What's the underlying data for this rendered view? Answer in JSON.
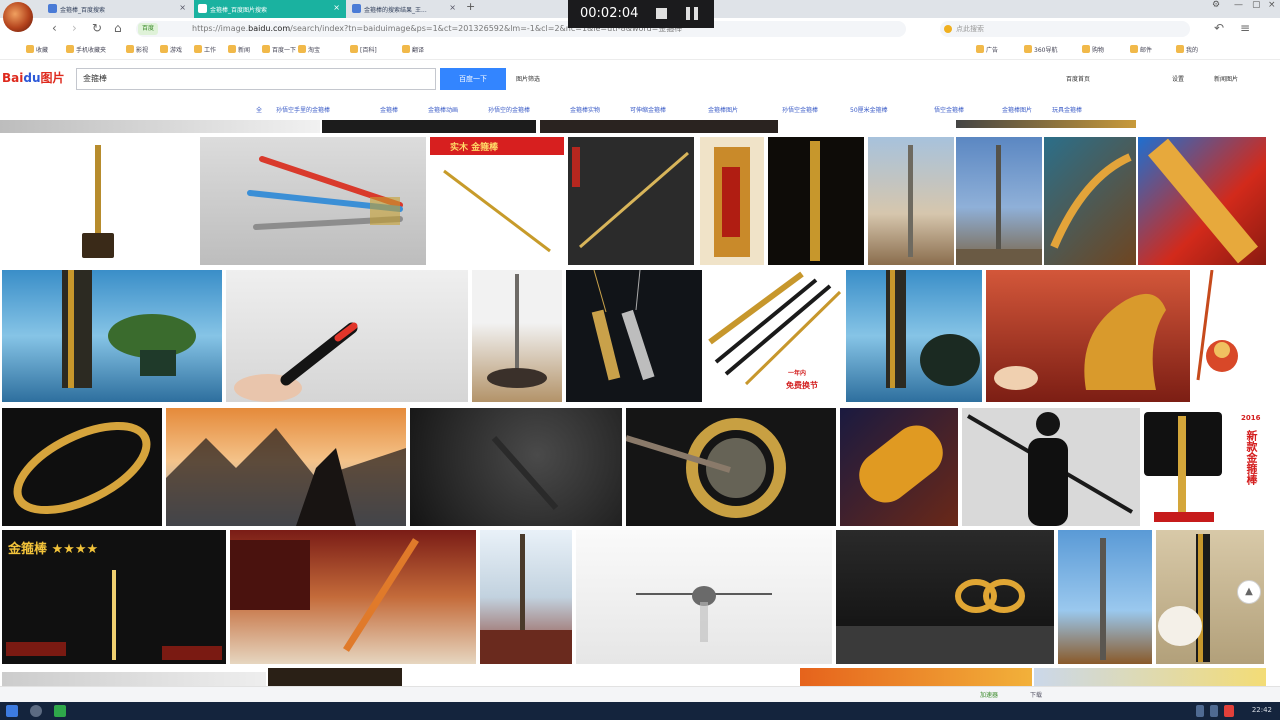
{
  "recorder": {
    "time": "00:02:04"
  },
  "tabs": [
    {
      "label": "金箍棒_百度搜索"
    },
    {
      "label": "金箍棒_百度图片搜索"
    },
    {
      "label": "金箍棒的搜索结果_王..."
    }
  ],
  "address": {
    "secure_tag": "百度",
    "url_prefix": "https://image.",
    "url_domain": "baidu.com",
    "url_rest": "/search/index?tn=baiduimage&ps=1&ct=201326592&lm=-1&cl=2&nc=1&ie=utf-8&word=金箍棒",
    "side_search": "点此搜索"
  },
  "bookmarks": [
    "收藏",
    "手机收藏夹",
    "影视",
    "游戏",
    "工作",
    "新闻",
    "百度一下",
    "淘宝",
    "[百科]",
    "翻译",
    "广告",
    "360导航",
    "购物",
    "邮件",
    "我的"
  ],
  "baidu": {
    "logo_text": "Bai",
    "logo_paw": "du",
    "logo_suffix": "图片",
    "query": "金箍棒",
    "search_button": "百度一下",
    "filter_link": "图片筛选",
    "right_links": [
      "百度首页",
      "设置",
      "新闻图片"
    ]
  },
  "suggestions": [
    "全",
    "孙悟空手里的金箍棒",
    "金箍棒",
    "金箍棒动画",
    "孙悟空的金箍棒",
    "金箍棒实物",
    "可伸缩金箍棒",
    "金箍棒图片",
    "孙悟空金箍棒",
    "50厘米金箍棒",
    "悟空金箍棒",
    "金箍棒图片",
    "玩具金箍棒"
  ],
  "tile_labels": {
    "red_banner": "实木 金箍棒",
    "promo_1": "一年内",
    "promo_2": "免费换节",
    "year": "2016",
    "new_style": "新款金箍棒",
    "game_title": "金箍棒 ★★★★"
  },
  "status": {
    "speed": "加速器",
    "download": "下载"
  },
  "taskbar": {
    "clock": "22:42"
  },
  "colors": {
    "baidu_blue": "#3385ff",
    "baidu_red": "#de2a1e",
    "active_tab": "#1ab2a0"
  }
}
